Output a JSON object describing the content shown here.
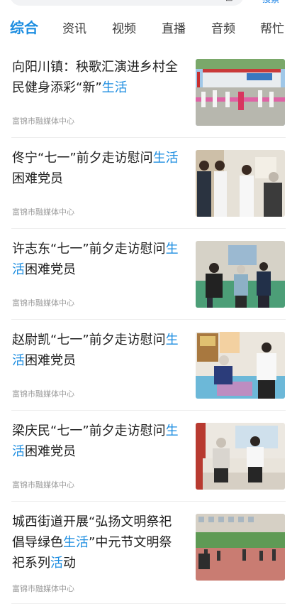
{
  "topbar": {
    "action_label": "搜索"
  },
  "tabs": [
    {
      "label": "综合",
      "active": true
    },
    {
      "label": "资讯",
      "active": false
    },
    {
      "label": "视频",
      "active": false
    },
    {
      "label": "直播",
      "active": false
    },
    {
      "label": "音频",
      "active": false
    },
    {
      "label": "帮忙",
      "active": false
    }
  ],
  "accent_color": "#1c8de0",
  "news": [
    {
      "title_parts": [
        {
          "text": "向阳川镇：秧歌汇演进乡村全民健身添彩“新”",
          "highlight": false
        },
        {
          "text": "生活",
          "highlight": true
        }
      ],
      "source": "富锦市融媒体中心"
    },
    {
      "title_parts": [
        {
          "text": "佟宁“七一”前夕走访慰问",
          "highlight": false
        },
        {
          "text": "生活",
          "highlight": true
        },
        {
          "text": "困难党员",
          "highlight": false
        }
      ],
      "source": "富锦市融媒体中心"
    },
    {
      "title_parts": [
        {
          "text": "许志东“七一”前夕走访慰问",
          "highlight": false
        },
        {
          "text": "生活",
          "highlight": true
        },
        {
          "text": "困难党员",
          "highlight": false
        }
      ],
      "source": "富锦市融媒体中心"
    },
    {
      "title_parts": [
        {
          "text": "赵尉凯“七一”前夕走访慰问",
          "highlight": false
        },
        {
          "text": "生活",
          "highlight": true
        },
        {
          "text": "困难党员",
          "highlight": false
        }
      ],
      "source": "富锦市融媒体中心"
    },
    {
      "title_parts": [
        {
          "text": "梁庆民“七一”前夕走访慰问",
          "highlight": false
        },
        {
          "text": "生活",
          "highlight": true
        },
        {
          "text": "困难党员",
          "highlight": false
        }
      ],
      "source": "富锦市融媒体中心"
    },
    {
      "title_parts": [
        {
          "text": "城西街道开展“弘扬文明祭祀倡导绿色",
          "highlight": false
        },
        {
          "text": "生活",
          "highlight": true
        },
        {
          "text": "”中元节文明祭祀系列",
          "highlight": false
        },
        {
          "text": "活",
          "highlight": true
        },
        {
          "text": "动",
          "highlight": false
        }
      ],
      "source": "富锦市融媒体中心"
    }
  ]
}
